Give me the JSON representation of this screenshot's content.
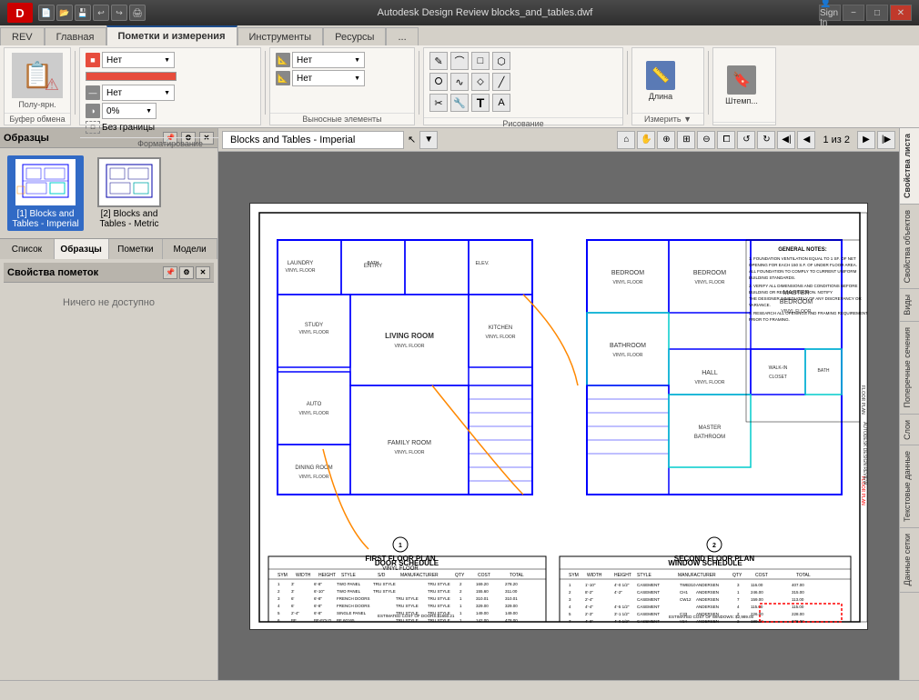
{
  "app": {
    "title": "Autodesk Design Review",
    "file": "blocks_and_tables.dwf",
    "full_title": "Autodesk Design Review    blocks_and_tables.dwf"
  },
  "ribbon": {
    "tabs": [
      "REV",
      "Главная",
      "Пометки и измерения",
      "Инструменты",
      "Ресурсы",
      "..."
    ],
    "active_tab": "Пометки и измерения",
    "groups": {
      "bufer": {
        "label": "Буфер обмена",
        "buttons": []
      },
      "formatirovaniye": {
        "label": "Форматирование"
      },
      "vynosnyye": {
        "label": "Выносные элементы"
      },
      "risovaniye": {
        "label": "Рисование"
      },
      "izmerit": {
        "label": "Измерить ▼"
      }
    },
    "measure_button": "Длина",
    "stamp_button": "Штемп...",
    "color_label": "Нет",
    "style_label": "Нет",
    "percent_label": "0%",
    "bez_granits": "Без границы"
  },
  "canvas": {
    "view_name": "Blocks and Tables - Imperial",
    "cursor_icon": "↖",
    "page_current": "1",
    "page_total": "2",
    "page_display": "1 из 2"
  },
  "left_panel": {
    "title": "Образцы",
    "thumbnails": [
      {
        "id": 1,
        "label": "[1] Blocks and Tables - Imperial",
        "selected": true
      },
      {
        "id": 2,
        "label": "[2] Blocks and Tables - Metric",
        "selected": false
      }
    ],
    "tabs": [
      "Список",
      "Образцы",
      "Пометки",
      "Модели"
    ],
    "active_tab": "Образцы",
    "properties_title": "Свойства пометок",
    "nothing_available": "Ничего не доступно"
  },
  "right_panel": {
    "tabs": [
      "Свойства листа",
      "Свойства объектов",
      "Виды",
      "Поперечные сечения",
      "Слои",
      "Текстовые данные",
      "Данные сетки"
    ],
    "active_tab": "Свойства листа"
  },
  "statusbar": {
    "text": ""
  },
  "toolbar": {
    "home_icon": "⌂",
    "hand_icon": "✋",
    "zoom_icon": "⊕",
    "fit_icon": "⊞",
    "nav_prev": "◀",
    "nav_next": "▶",
    "nav_first": "◀◀",
    "nav_last": "▶▶"
  }
}
